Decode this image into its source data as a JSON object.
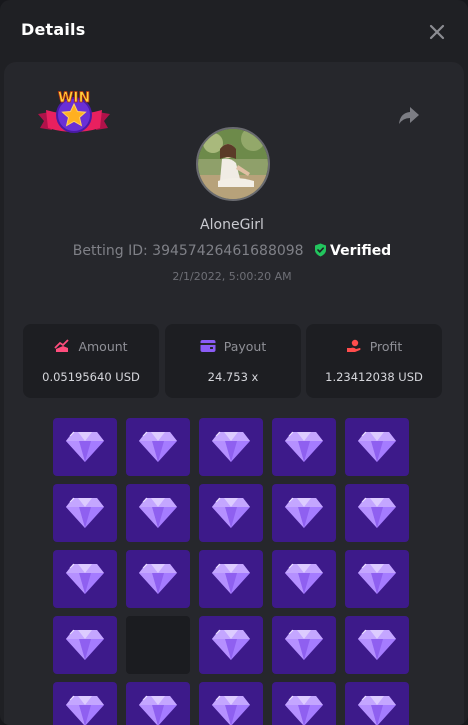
{
  "dialog": {
    "title": "Details"
  },
  "bet": {
    "username": "AloneGirl",
    "betting_id_label": "Betting ID:",
    "betting_id": "39457426461688098",
    "verified_label": "Verified",
    "timestamp": "2/1/2022, 5:00:20 AM"
  },
  "badge": {
    "text": "WIN"
  },
  "stats": {
    "amount": {
      "label": "Amount",
      "value": "0.05195640 USD"
    },
    "payout": {
      "label": "Payout",
      "value": "24.753 x"
    },
    "profit": {
      "label": "Profit",
      "value": "1.23412038 USD"
    }
  },
  "board": {
    "columns": 5,
    "rows": [
      [
        "gem",
        "gem",
        "gem",
        "gem",
        "gem"
      ],
      [
        "gem",
        "gem",
        "gem",
        "gem",
        "gem"
      ],
      [
        "gem",
        "gem",
        "gem",
        "gem",
        "gem"
      ],
      [
        "gem",
        "empty",
        "gem",
        "gem",
        "gem"
      ],
      [
        "gem",
        "gem",
        "gem",
        "gem",
        "gem"
      ]
    ]
  },
  "colors": {
    "tile": "#3d1a8a",
    "gem": "#a57cff",
    "verified": "#22c55e",
    "amount_icon": "#ff4d7d",
    "payout_icon": "#8b5cf6",
    "profit_icon": "#ff4d4d"
  },
  "icons": {
    "close": "close-icon",
    "share": "share-icon",
    "verified": "verified-shield-icon",
    "amount": "amount-icon",
    "payout": "wallet-icon",
    "profit": "profit-hand-icon",
    "tile": "diamond-icon"
  }
}
